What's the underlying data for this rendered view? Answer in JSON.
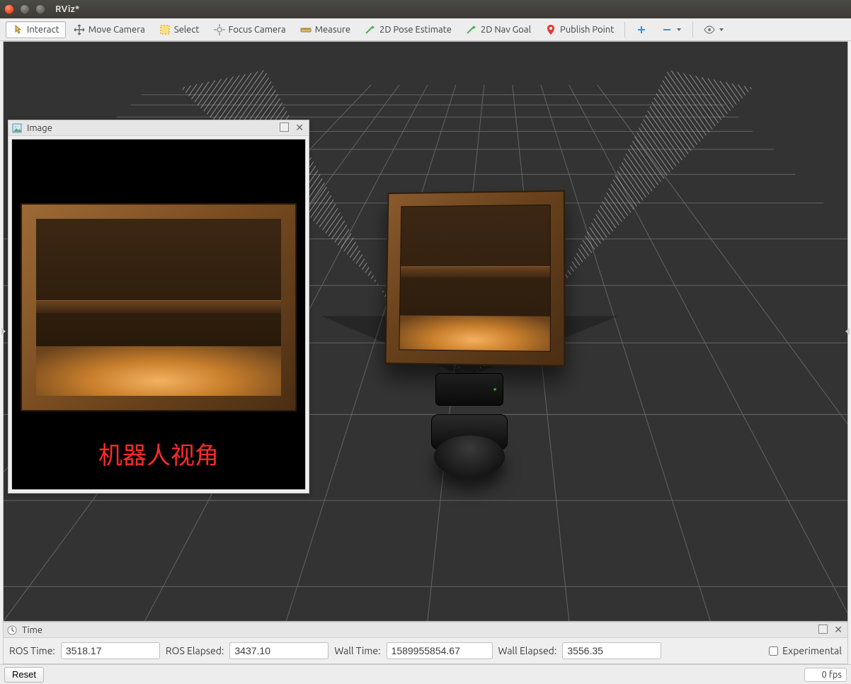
{
  "window": {
    "title": "RViz*"
  },
  "toolbar": {
    "interact": "Interact",
    "move_camera": "Move Camera",
    "select": "Select",
    "focus_camera": "Focus Camera",
    "measure": "Measure",
    "pose_estimate": "2D Pose Estimate",
    "nav_goal": "2D Nav Goal",
    "publish_point": "Publish Point"
  },
  "image_panel": {
    "title": "Image",
    "caption": "机器人视角"
  },
  "time": {
    "panel_title": "Time",
    "ros_time_label": "ROS Time:",
    "ros_time": "3518.17",
    "ros_elapsed_label": "ROS Elapsed:",
    "ros_elapsed": "3437.10",
    "wall_time_label": "Wall Time:",
    "wall_time": "1589955854.67",
    "wall_elapsed_label": "Wall Elapsed:",
    "wall_elapsed": "3556.35",
    "experimental_label": "Experimental"
  },
  "bottom": {
    "reset": "Reset",
    "fps": "0 fps"
  }
}
